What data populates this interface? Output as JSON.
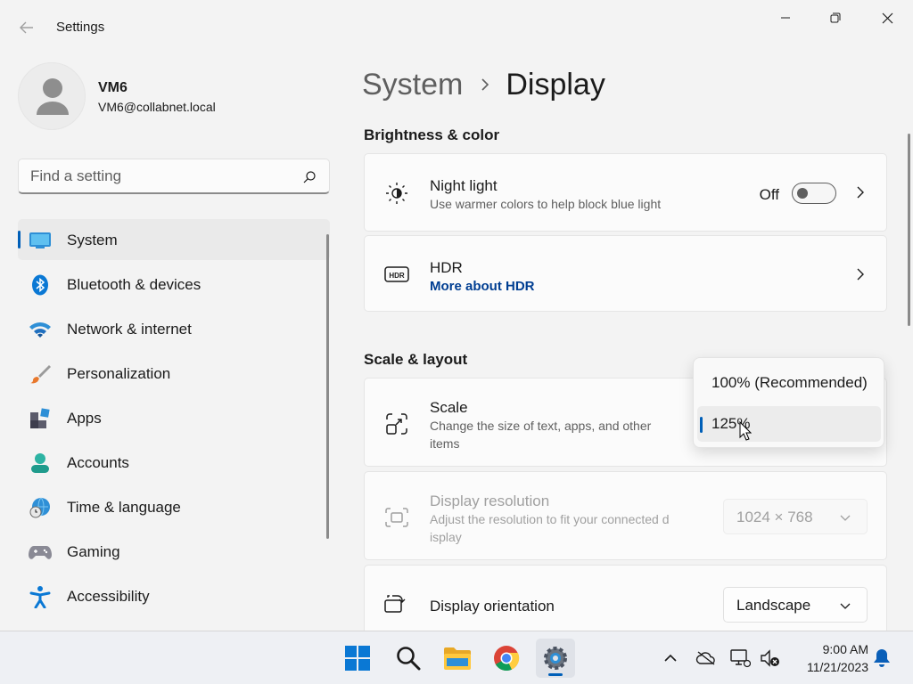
{
  "window": {
    "app_title": "Settings",
    "back_icon": "back-arrow-icon",
    "controls": [
      "minimize-icon",
      "maximize-icon",
      "close-icon"
    ]
  },
  "profile": {
    "name": "VM6",
    "email": "VM6@collabnet.local"
  },
  "search": {
    "placeholder": "Find a setting",
    "icon": "search-icon"
  },
  "sidebar": {
    "items": [
      {
        "label": "System",
        "icon": "system-icon",
        "active": true
      },
      {
        "label": "Bluetooth & devices",
        "icon": "bluetooth-icon"
      },
      {
        "label": "Network & internet",
        "icon": "wifi-icon"
      },
      {
        "label": "Personalization",
        "icon": "brush-icon"
      },
      {
        "label": "Apps",
        "icon": "apps-icon"
      },
      {
        "label": "Accounts",
        "icon": "accounts-icon"
      },
      {
        "label": "Time & language",
        "icon": "globe-clock-icon"
      },
      {
        "label": "Gaming",
        "icon": "gamepad-icon"
      },
      {
        "label": "Accessibility",
        "icon": "accessibility-icon"
      }
    ]
  },
  "breadcrumb": {
    "parent": "System",
    "current": "Display"
  },
  "sections": {
    "brightness": "Brightness & color",
    "scale_layout": "Scale & layout"
  },
  "night_light": {
    "title": "Night light",
    "subtitle": "Use warmer colors to help block blue light",
    "toggle_label": "Off",
    "toggle_on": false
  },
  "hdr": {
    "title": "HDR",
    "link": "More about HDR"
  },
  "scale": {
    "title": "Scale",
    "subtitle_line1": "Change the size of text, apps, and other",
    "subtitle_line2": "items",
    "options": [
      "100% (Recommended)",
      "125%"
    ],
    "selected": "125%"
  },
  "resolution": {
    "title": "Display resolution",
    "subtitle_line1": "Adjust the resolution to fit your connected d",
    "subtitle_line2": "isplay",
    "value": "1024 × 768"
  },
  "orientation": {
    "title": "Display orientation",
    "value": "Landscape"
  },
  "taskbar": {
    "apps": [
      "start-icon",
      "search-icon",
      "file-explorer-icon",
      "chrome-icon",
      "settings-icon"
    ],
    "tray": [
      "chevron-up-icon",
      "onedrive-icon",
      "network-icon",
      "speaker-muted-icon"
    ],
    "time": "9:00 AM",
    "date": "11/21/2023",
    "notification_icon": "bell-icon"
  },
  "colors": {
    "accent": "#005fb8",
    "link": "#003e92"
  }
}
